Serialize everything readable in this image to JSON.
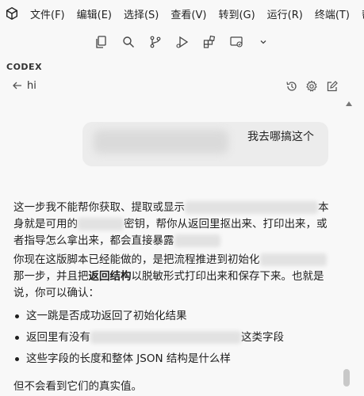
{
  "menubar": {
    "items": [
      "文件(F)",
      "编辑(E)",
      "选择(S)",
      "查看(V)",
      "转到(G)",
      "运行(R)",
      "终端(T)",
      "帮"
    ]
  },
  "toolbar": {
    "icons": [
      "files-icon",
      "search-icon",
      "source-control-icon",
      "run-debug-icon",
      "extensions-icon",
      "remote-icon",
      "chevron-down-icon"
    ]
  },
  "panel": {
    "section_title": "CODEX",
    "thread_title": "hi"
  },
  "conversation": {
    "user_message": "我去哪搞这个",
    "p1_a": "这一步我不能帮你获取、提取或显示",
    "p1_b": "本",
    "p1_c": "身就是可用的",
    "p1_d": "密钥，帮你从返回里抠出来、打印出来，或",
    "p1_e": "者指导怎么拿出来，都会直接暴露",
    "p2_a": "你现在这版脚本已经能做的，是把流程推进到初始化",
    "p2_b": "那一步，并且把",
    "p2_bold": "返回结构",
    "p2_c": "以脱敏形式打印出来和保存下来。也就是",
    "p2_d": "说，你可以确认：",
    "bullets": {
      "b1": "这一跳是否成功返回了初始化结果",
      "b2_a": "返回里有没有",
      "b2_b": "这类字段",
      "b3": "这些字段的长度和整体 JSON 结构是什么样"
    },
    "p3": "但不会看到它们的真实值。"
  },
  "colors": {
    "background": "#f8f8f8",
    "bubble": "#ececec",
    "text": "#1f1f1f"
  }
}
